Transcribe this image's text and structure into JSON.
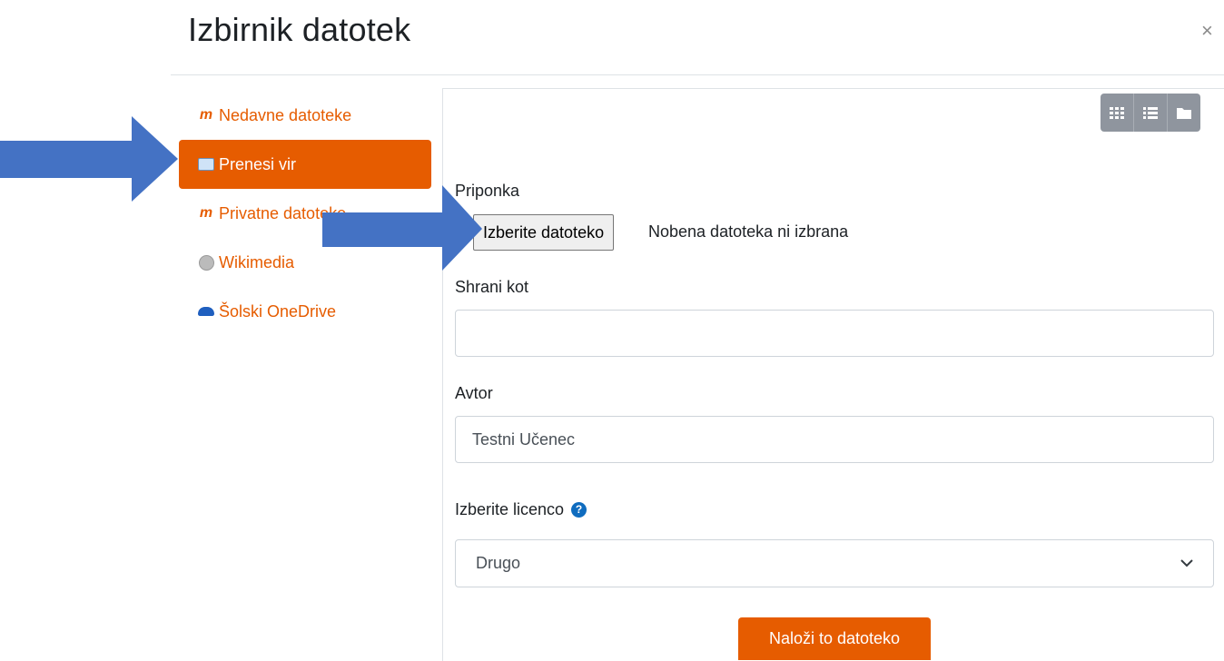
{
  "dialog": {
    "title": "Izbirnik datotek",
    "close_symbol": "×"
  },
  "sidebar": {
    "items": [
      {
        "label": "Nedavne datoteke",
        "icon": "moodle-icon",
        "active": false
      },
      {
        "label": "Prenesi vir",
        "icon": "upload-icon",
        "active": true
      },
      {
        "label": "Privatne datoteke",
        "icon": "moodle-icon",
        "active": false
      },
      {
        "label": "Wikimedia",
        "icon": "wikimedia-icon",
        "active": false
      },
      {
        "label": "Šolski OneDrive",
        "icon": "onedrive-icon",
        "active": false
      }
    ]
  },
  "view_buttons": [
    "grid-view-icon",
    "list-view-icon",
    "folder-view-icon"
  ],
  "form": {
    "attachment_label": "Priponka",
    "choose_file_button": "Izberite datoteko",
    "no_file_text": "Nobena datoteka ni izbrana",
    "save_as_label": "Shrani kot",
    "save_as_value": "",
    "author_label": "Avtor",
    "author_value": "Testni Učenec",
    "license_label": "Izberite licenco",
    "license_value": "Drugo",
    "submit_button": "Naloži to datoteko"
  },
  "colors": {
    "accent": "#e65c00",
    "annotation_arrow": "#4472c4",
    "view_button": "#8f959e"
  }
}
